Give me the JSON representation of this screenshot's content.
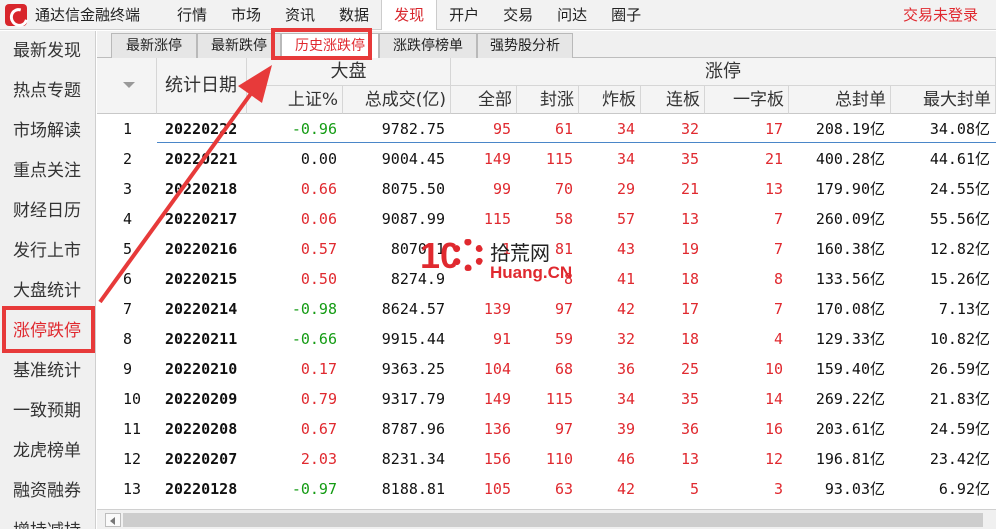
{
  "menubar": {
    "app_title": "通达信金融终端",
    "items": [
      "行情",
      "市场",
      "资讯",
      "数据",
      "发现",
      "开户",
      "交易",
      "问达",
      "圈子"
    ],
    "active_index": 4,
    "login_status": "交易未登录"
  },
  "sidebar": {
    "items": [
      "最新发现",
      "热点专题",
      "市场解读",
      "重点关注",
      "财经日历",
      "发行上市",
      "大盘统计",
      "涨停跌停",
      "基准统计",
      "一致预期",
      "龙虎榜单",
      "融资融券",
      "增持减持"
    ],
    "active_index": 7
  },
  "tabs": {
    "items": [
      "最新涨停",
      "最新跌停",
      "历史涨跌停",
      "涨跌停榜单",
      "强势股分析"
    ],
    "active_index": 2
  },
  "table": {
    "date_header": "统计日期",
    "group_dapan": "大盘",
    "group_zhangting": "涨停",
    "columns": [
      "上证%",
      "总成交(亿)",
      "全部",
      "封涨",
      "炸板",
      "连板",
      "一字板",
      "总封单",
      "最大封单"
    ],
    "rows": [
      {
        "n": "1",
        "date": "20220222",
        "sh": "-0.96",
        "vol": "9782.75",
        "all": "95",
        "seal": "61",
        "burst": "34",
        "lian": "32",
        "yizi": "17",
        "total": "208.19亿",
        "max": "34.08亿"
      },
      {
        "n": "2",
        "date": "20220221",
        "sh": "0.00",
        "vol": "9004.45",
        "all": "149",
        "seal": "115",
        "burst": "34",
        "lian": "35",
        "yizi": "21",
        "total": "400.28亿",
        "max": "44.61亿"
      },
      {
        "n": "3",
        "date": "20220218",
        "sh": "0.66",
        "vol": "8075.50",
        "all": "99",
        "seal": "70",
        "burst": "29",
        "lian": "21",
        "yizi": "13",
        "total": "179.90亿",
        "max": "24.55亿"
      },
      {
        "n": "4",
        "date": "20220217",
        "sh": "0.06",
        "vol": "9087.99",
        "all": "115",
        "seal": "58",
        "burst": "57",
        "lian": "13",
        "yizi": "7",
        "total": "260.09亿",
        "max": "55.56亿"
      },
      {
        "n": "5",
        "date": "20220216",
        "sh": "0.57",
        "vol": "8070.1",
        "all": "1",
        "seal": "81",
        "burst": "43",
        "lian": "19",
        "yizi": "7",
        "total": "160.38亿",
        "max": "12.82亿"
      },
      {
        "n": "6",
        "date": "20220215",
        "sh": "0.50",
        "vol": "8274.9",
        "all": "",
        "seal": "8",
        "burst": "41",
        "lian": "18",
        "yizi": "8",
        "total": "133.56亿",
        "max": "15.26亿"
      },
      {
        "n": "7",
        "date": "20220214",
        "sh": "-0.98",
        "vol": "8624.57",
        "all": "139",
        "seal": "97",
        "burst": "42",
        "lian": "17",
        "yizi": "7",
        "total": "170.08亿",
        "max": "7.13亿"
      },
      {
        "n": "8",
        "date": "20220211",
        "sh": "-0.66",
        "vol": "9915.44",
        "all": "91",
        "seal": "59",
        "burst": "32",
        "lian": "18",
        "yizi": "4",
        "total": "129.33亿",
        "max": "10.82亿"
      },
      {
        "n": "9",
        "date": "20220210",
        "sh": "0.17",
        "vol": "9363.25",
        "all": "104",
        "seal": "68",
        "burst": "36",
        "lian": "25",
        "yizi": "10",
        "total": "159.40亿",
        "max": "26.59亿"
      },
      {
        "n": "10",
        "date": "20220209",
        "sh": "0.79",
        "vol": "9317.79",
        "all": "149",
        "seal": "115",
        "burst": "34",
        "lian": "35",
        "yizi": "14",
        "total": "269.22亿",
        "max": "21.83亿"
      },
      {
        "n": "11",
        "date": "20220208",
        "sh": "0.67",
        "vol": "8787.96",
        "all": "136",
        "seal": "97",
        "burst": "39",
        "lian": "36",
        "yizi": "16",
        "total": "203.61亿",
        "max": "24.59亿"
      },
      {
        "n": "12",
        "date": "20220207",
        "sh": "2.03",
        "vol": "8231.34",
        "all": "156",
        "seal": "110",
        "burst": "46",
        "lian": "13",
        "yizi": "12",
        "total": "196.81亿",
        "max": "23.42亿"
      },
      {
        "n": "13",
        "date": "20220128",
        "sh": "-0.97",
        "vol": "8188.81",
        "all": "105",
        "seal": "63",
        "burst": "42",
        "lian": "5",
        "yizi": "3",
        "total": "93.03亿",
        "max": "6.92亿"
      }
    ]
  },
  "watermark": {
    "ten": "10",
    "cn": "拾荒网",
    "en": "Huang.CN"
  },
  "colors": {
    "up": "#e0292f",
    "down": "#139b13",
    "flat": "#111111",
    "highlight": "#e73a3a"
  }
}
